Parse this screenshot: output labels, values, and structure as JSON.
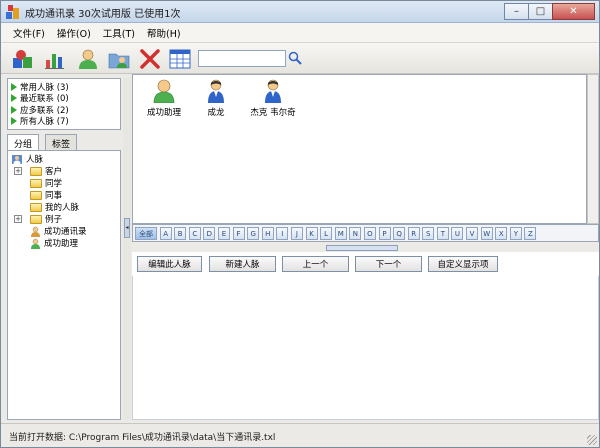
{
  "window": {
    "title": "成功通讯录 30次试用版 已使用1次"
  },
  "menu": [
    {
      "label": "文件(F)"
    },
    {
      "label": "操作(O)"
    },
    {
      "label": "工具(T)"
    },
    {
      "label": "帮助(H)"
    }
  ],
  "toolbar": {
    "icons": [
      "category-icon",
      "chart-icon",
      "person-icon",
      "folder-person-icon",
      "delete-icon",
      "grid-icon",
      "search-icon"
    ],
    "search": {
      "value": "",
      "placeholder": ""
    }
  },
  "quick": [
    {
      "label": "常用人脉 (3)"
    },
    {
      "label": "最近联系 (0)"
    },
    {
      "label": "应多联系 (2)"
    },
    {
      "label": "所有人脉 (7)"
    }
  ],
  "tabs": [
    {
      "label": "分组",
      "active": true
    },
    {
      "label": "标签",
      "active": false
    }
  ],
  "tree": {
    "root": "人脉",
    "items": [
      {
        "label": "客户",
        "expandable": true,
        "icon": "folder"
      },
      {
        "label": "同学",
        "expandable": false,
        "icon": "folder"
      },
      {
        "label": "同事",
        "expandable": false,
        "icon": "folder"
      },
      {
        "label": "我的人脉",
        "expandable": false,
        "icon": "folder"
      },
      {
        "label": "例子",
        "expandable": true,
        "icon": "folder"
      },
      {
        "label": "成功通讯录",
        "expandable": false,
        "icon": "person"
      },
      {
        "label": "成功助理",
        "expandable": false,
        "icon": "person"
      }
    ]
  },
  "contacts": [
    {
      "name": "成功助理",
      "icon": "green-person"
    },
    {
      "name": "成龙",
      "icon": "blue-person"
    },
    {
      "name": "杰克 韦尔奇",
      "icon": "blue-person"
    }
  ],
  "alphabet": [
    "全部",
    "A",
    "B",
    "C",
    "D",
    "E",
    "F",
    "G",
    "H",
    "I",
    "J",
    "K",
    "L",
    "M",
    "N",
    "O",
    "P",
    "Q",
    "R",
    "S",
    "T",
    "U",
    "V",
    "W",
    "X",
    "Y",
    "Z"
  ],
  "actions": {
    "edit": "编辑此人脉",
    "new": "新建人脉",
    "prev": "上一个",
    "next": "下一个",
    "custom": "自定义显示项"
  },
  "status": {
    "text": "当前打开数据: C:\\Program Files\\成功通讯录\\data\\当下通讯录.txl"
  },
  "colors": {
    "accent": "#2fa82f",
    "window_border": "#7a8a99",
    "title_bar": "#c5d6ea"
  }
}
